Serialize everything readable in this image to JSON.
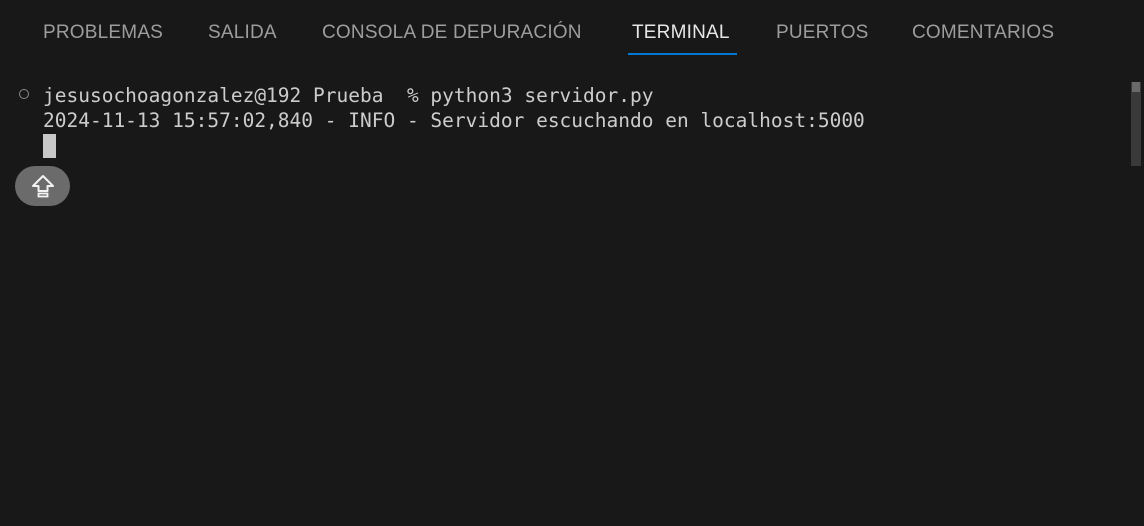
{
  "tabs": {
    "problems": "PROBLEMAS",
    "output": "SALIDA",
    "debug_console": "CONSOLA DE DEPURACIÓN",
    "terminal": "TERMINAL",
    "ports": "PUERTOS",
    "comments": "COMENTARIOS",
    "active": "TERMINAL"
  },
  "terminal": {
    "lines": [
      "jesusochoagonzalez@192 Prueba  % python3 servidor.py",
      "2024-11-13 15:57:02,840 - INFO - Servidor escuchando en localhost:5000"
    ]
  },
  "icons": {
    "command_decoration": "circle-outline-icon",
    "scroll_to_bottom": "shift-up-arrow-icon"
  },
  "colors": {
    "background": "#181818",
    "active_tab_underline": "#0078d4",
    "text": "#cccccc",
    "inactive_tab": "#9d9d9d"
  }
}
